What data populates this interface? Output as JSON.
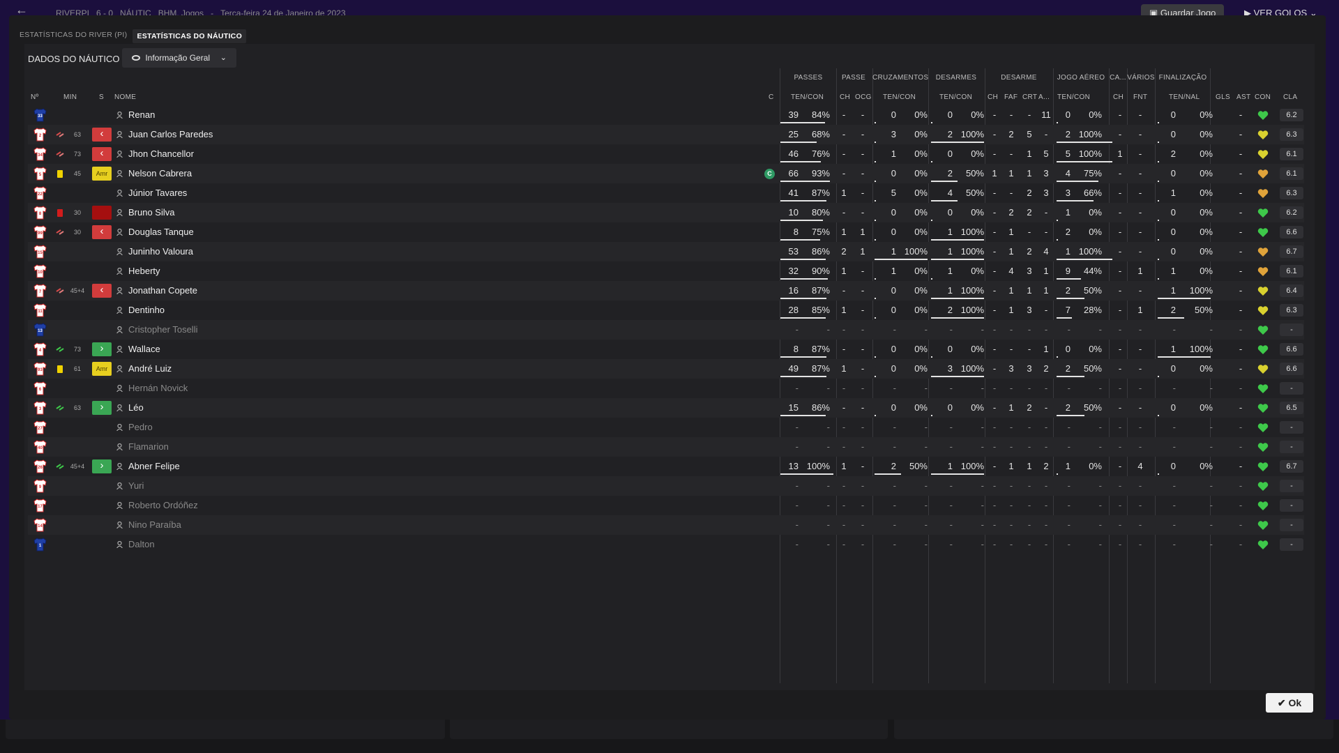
{
  "topbar": {
    "back_icon": "arrow-left-icon",
    "crumb": [
      "RIVERPI",
      "6 - 0",
      "NÁUTIC",
      "BHM. Jogos",
      "-",
      "Terça-feira 24 de Janeiro de 2023"
    ],
    "save_label": "Guardar Jogo",
    "goals_label": "VER GOLOS"
  },
  "tabs": [
    {
      "label": "ESTATÍSTICAS DO RIVER (PI)",
      "active": false
    },
    {
      "label": "ESTATÍSTICAS DO NÁUTICO",
      "active": true
    }
  ],
  "section_title": "DADOS DO NÁUTICO",
  "view_select": {
    "label": "Informação Geral",
    "icon": "eye-icon"
  },
  "groups": [
    "PASSES",
    "PASSE",
    "CRUZAMENTOS",
    "DESARMES",
    "DESARME",
    "JOGO AÉREO",
    "CA...",
    "VÁRIOS",
    "FINALIZAÇÃO"
  ],
  "headers": {
    "no": "Nº",
    "min": "MIN",
    "s": "S",
    "nome": "NOME",
    "c": "C",
    "passes": "TEN/CON",
    "passe_ch": "CH",
    "passe_ocg": "OCG",
    "cruz": "TEN/CON",
    "desarmes": "TEN/CON",
    "des_ch": "CH",
    "des_faf": "FAF",
    "des_crt": "CRT",
    "des_a": "A...",
    "aereo": "TEN/CON",
    "ca_ch": "CH",
    "varios_fnt": "FNT",
    "final": "TEN/NAL",
    "gls": "GLS",
    "ast": "AST",
    "con": "CON",
    "cla": "CLA"
  },
  "players": [
    {
      "no": "33",
      "gk": true,
      "min": "",
      "event": "",
      "badge": "",
      "name": "Renan",
      "dim": false,
      "c": false,
      "p": [
        "39",
        "84%"
      ],
      "pch": "-",
      "pocg": "-",
      "cr": [
        "0",
        "0%"
      ],
      "de": [
        "0",
        "0%"
      ],
      "dch": "-",
      "faf": "-",
      "crt": "-",
      "a": "11",
      "ae": [
        "0",
        "0%"
      ],
      "cach": "-",
      "fnt": "-",
      "fin": [
        "0",
        "0%"
      ],
      "gls": "",
      "ast": "-",
      "con": "green",
      "cla": "6.2"
    },
    {
      "no": "2",
      "gk": false,
      "min": "63",
      "event": "swap",
      "badge": "sub-off",
      "name": "Juan Carlos Paredes",
      "dim": false,
      "c": false,
      "p": [
        "25",
        "68%"
      ],
      "pch": "-",
      "pocg": "-",
      "cr": [
        "3",
        "0%"
      ],
      "de": [
        "2",
        "100%"
      ],
      "dch": "-",
      "faf": "2",
      "crt": "5",
      "a": "-",
      "ae": [
        "2",
        "100%"
      ],
      "cach": "-",
      "fnt": "-",
      "fin": [
        "0",
        "0%"
      ],
      "gls": "",
      "ast": "-",
      "con": "yellow",
      "cla": "6.3"
    },
    {
      "no": "34",
      "gk": false,
      "min": "73",
      "event": "swap",
      "badge": "sub-off",
      "name": "Jhon Chancellor",
      "dim": false,
      "c": false,
      "p": [
        "46",
        "76%"
      ],
      "pch": "-",
      "pocg": "-",
      "cr": [
        "1",
        "0%"
      ],
      "de": [
        "0",
        "0%"
      ],
      "dch": "-",
      "faf": "-",
      "crt": "1",
      "a": "5",
      "ae": [
        "5",
        "100%"
      ],
      "cach": "1",
      "fnt": "-",
      "fin": [
        "2",
        "0%"
      ],
      "gls": "",
      "ast": "-",
      "con": "yellow",
      "cla": "6.1"
    },
    {
      "no": "5",
      "gk": false,
      "min": "45",
      "event": "yellow",
      "badge": "amr",
      "name": "Nelson Cabrera",
      "dim": false,
      "c": true,
      "p": [
        "66",
        "93%"
      ],
      "pch": "-",
      "pocg": "-",
      "cr": [
        "0",
        "0%"
      ],
      "de": [
        "2",
        "50%"
      ],
      "dch": "1",
      "faf": "1",
      "crt": "1",
      "a": "3",
      "ae": [
        "4",
        "75%"
      ],
      "cach": "-",
      "fnt": "-",
      "fin": [
        "0",
        "0%"
      ],
      "gls": "",
      "ast": "-",
      "con": "orange",
      "cla": "6.1"
    },
    {
      "no": "22",
      "gk": false,
      "min": "",
      "event": "",
      "badge": "",
      "name": "Júnior Tavares",
      "dim": false,
      "c": false,
      "p": [
        "41",
        "87%"
      ],
      "pch": "1",
      "pocg": "-",
      "cr": [
        "5",
        "0%"
      ],
      "de": [
        "4",
        "50%"
      ],
      "dch": "-",
      "faf": "-",
      "crt": "2",
      "a": "3",
      "ae": [
        "3",
        "66%"
      ],
      "cach": "-",
      "fnt": "-",
      "fin": [
        "1",
        "0%"
      ],
      "gls": "",
      "ast": "-",
      "con": "orange",
      "cla": "6.3"
    },
    {
      "no": "8",
      "gk": false,
      "min": "30",
      "event": "red",
      "badge": "red",
      "name": "Bruno Silva",
      "dim": false,
      "c": false,
      "p": [
        "10",
        "80%"
      ],
      "pch": "-",
      "pocg": "-",
      "cr": [
        "0",
        "0%"
      ],
      "de": [
        "0",
        "0%"
      ],
      "dch": "-",
      "faf": "2",
      "crt": "2",
      "a": "-",
      "ae": [
        "1",
        "0%"
      ],
      "cach": "-",
      "fnt": "-",
      "fin": [
        "0",
        "0%"
      ],
      "gls": "",
      "ast": "-",
      "con": "green",
      "cla": "6.2"
    },
    {
      "no": "99",
      "gk": false,
      "min": "30",
      "event": "swap",
      "badge": "sub-off",
      "name": "Douglas Tanque",
      "dim": false,
      "c": false,
      "p": [
        "8",
        "75%"
      ],
      "pch": "1",
      "pocg": "1",
      "cr": [
        "0",
        "0%"
      ],
      "de": [
        "1",
        "100%"
      ],
      "dch": "-",
      "faf": "1",
      "crt": "-",
      "a": "-",
      "ae": [
        "2",
        "0%"
      ],
      "cach": "-",
      "fnt": "-",
      "fin": [
        "0",
        "0%"
      ],
      "gls": "",
      "ast": "-",
      "con": "green",
      "cla": "6.6"
    },
    {
      "no": "15",
      "gk": false,
      "min": "",
      "event": "",
      "badge": "",
      "name": "Juninho Valoura",
      "dim": false,
      "c": false,
      "p": [
        "53",
        "86%"
      ],
      "pch": "2",
      "pocg": "1",
      "cr": [
        "1",
        "100%"
      ],
      "de": [
        "1",
        "100%"
      ],
      "dch": "-",
      "faf": "1",
      "crt": "2",
      "a": "4",
      "ae": [
        "1",
        "100%"
      ],
      "cach": "-",
      "fnt": "-",
      "fin": [
        "0",
        "0%"
      ],
      "gls": "",
      "ast": "-",
      "con": "orange",
      "cla": "6.7"
    },
    {
      "no": "10",
      "gk": false,
      "min": "",
      "event": "",
      "badge": "",
      "name": "Heberty",
      "dim": false,
      "c": false,
      "p": [
        "32",
        "90%"
      ],
      "pch": "1",
      "pocg": "-",
      "cr": [
        "1",
        "0%"
      ],
      "de": [
        "1",
        "0%"
      ],
      "dch": "-",
      "faf": "4",
      "crt": "3",
      "a": "1",
      "ae": [
        "9",
        "44%"
      ],
      "cach": "-",
      "fnt": "1",
      "fin": [
        "1",
        "0%"
      ],
      "gls": "",
      "ast": "-",
      "con": "orange",
      "cla": "6.1"
    },
    {
      "no": "7",
      "gk": false,
      "min": "45+4",
      "event": "swap",
      "badge": "sub-off",
      "name": "Jonathan Copete",
      "dim": false,
      "c": false,
      "p": [
        "16",
        "87%"
      ],
      "pch": "-",
      "pocg": "-",
      "cr": [
        "0",
        "0%"
      ],
      "de": [
        "1",
        "100%"
      ],
      "dch": "-",
      "faf": "1",
      "crt": "1",
      "a": "1",
      "ae": [
        "2",
        "50%"
      ],
      "cach": "-",
      "fnt": "-",
      "fin": [
        "1",
        "100%"
      ],
      "gls": "",
      "ast": "-",
      "con": "yellow",
      "cla": "6.4"
    },
    {
      "no": "11",
      "gk": false,
      "min": "",
      "event": "",
      "badge": "",
      "name": "Dentinho",
      "dim": false,
      "c": false,
      "p": [
        "28",
        "85%"
      ],
      "pch": "1",
      "pocg": "-",
      "cr": [
        "0",
        "0%"
      ],
      "de": [
        "2",
        "100%"
      ],
      "dch": "-",
      "faf": "1",
      "crt": "3",
      "a": "-",
      "ae": [
        "7",
        "28%"
      ],
      "cach": "-",
      "fnt": "1",
      "fin": [
        "2",
        "50%"
      ],
      "gls": "",
      "ast": "-",
      "con": "yellow",
      "cla": "6.3"
    },
    {
      "no": "13",
      "gk": true,
      "min": "",
      "event": "",
      "badge": "",
      "name": "Cristopher Toselli",
      "dim": true,
      "c": false,
      "p": [
        "-",
        "-"
      ],
      "pch": "-",
      "pocg": "-",
      "cr": [
        "-",
        "-"
      ],
      "de": [
        "-",
        "-"
      ],
      "dch": "-",
      "faf": "-",
      "crt": "-",
      "a": "-",
      "ae": [
        "-",
        "-"
      ],
      "cach": "-",
      "fnt": "-",
      "fin": [
        "-",
        "-"
      ],
      "gls": "",
      "ast": "-",
      "con": "green",
      "cla": "-"
    },
    {
      "no": "4",
      "gk": false,
      "min": "73",
      "event": "swap-in",
      "badge": "sub-on",
      "name": "Wallace",
      "dim": false,
      "c": false,
      "p": [
        "8",
        "87%"
      ],
      "pch": "-",
      "pocg": "-",
      "cr": [
        "0",
        "0%"
      ],
      "de": [
        "0",
        "0%"
      ],
      "dch": "-",
      "faf": "-",
      "crt": "-",
      "a": "1",
      "ae": [
        "0",
        "0%"
      ],
      "cach": "-",
      "fnt": "-",
      "fin": [
        "1",
        "100%"
      ],
      "gls": "",
      "ast": "-",
      "con": "green",
      "cla": "6.6"
    },
    {
      "no": "93",
      "gk": false,
      "min": "61",
      "event": "yellow",
      "badge": "amr",
      "name": "André Luiz",
      "dim": false,
      "c": false,
      "p": [
        "49",
        "87%"
      ],
      "pch": "1",
      "pocg": "-",
      "cr": [
        "0",
        "0%"
      ],
      "de": [
        "3",
        "100%"
      ],
      "dch": "-",
      "faf": "3",
      "crt": "3",
      "a": "2",
      "ae": [
        "2",
        "50%"
      ],
      "cach": "-",
      "fnt": "-",
      "fin": [
        "0",
        "0%"
      ],
      "gls": "",
      "ast": "-",
      "con": "yellow",
      "cla": "6.6"
    },
    {
      "no": "6",
      "gk": false,
      "min": "",
      "event": "",
      "badge": "",
      "name": "Hernán Novick",
      "dim": true,
      "c": false,
      "p": [
        "-",
        "-"
      ],
      "pch": "-",
      "pocg": "-",
      "cr": [
        "-",
        "-"
      ],
      "de": [
        "-",
        "-"
      ],
      "dch": "-",
      "faf": "-",
      "crt": "-",
      "a": "-",
      "ae": [
        "-",
        "-"
      ],
      "cach": "-",
      "fnt": "-",
      "fin": [
        "-",
        "-"
      ],
      "gls": "",
      "ast": "-",
      "con": "green",
      "cla": "-"
    },
    {
      "no": "3",
      "gk": false,
      "min": "63",
      "event": "swap-in",
      "badge": "sub-on",
      "name": "Léo",
      "dim": false,
      "c": false,
      "p": [
        "15",
        "86%"
      ],
      "pch": "-",
      "pocg": "-",
      "cr": [
        "0",
        "0%"
      ],
      "de": [
        "0",
        "0%"
      ],
      "dch": "-",
      "faf": "1",
      "crt": "2",
      "a": "-",
      "ae": [
        "2",
        "50%"
      ],
      "cach": "-",
      "fnt": "-",
      "fin": [
        "0",
        "0%"
      ],
      "gls": "",
      "ast": "-",
      "con": "green",
      "cla": "6.5"
    },
    {
      "no": "27",
      "gk": false,
      "min": "",
      "event": "",
      "badge": "",
      "name": "Pedro",
      "dim": true,
      "c": false,
      "p": [
        "-",
        "-"
      ],
      "pch": "-",
      "pocg": "-",
      "cr": [
        "-",
        "-"
      ],
      "de": [
        "-",
        "-"
      ],
      "dch": "-",
      "faf": "-",
      "crt": "-",
      "a": "-",
      "ae": [
        "-",
        "-"
      ],
      "cach": "-",
      "fnt": "-",
      "fin": [
        "-",
        "-"
      ],
      "gls": "",
      "ast": "-",
      "con": "green",
      "cla": "-"
    },
    {
      "no": "40",
      "gk": false,
      "min": "",
      "event": "",
      "badge": "",
      "name": "Flamarion",
      "dim": true,
      "c": false,
      "p": [
        "-",
        "-"
      ],
      "pch": "-",
      "pocg": "-",
      "cr": [
        "-",
        "-"
      ],
      "de": [
        "-",
        "-"
      ],
      "dch": "-",
      "faf": "-",
      "crt": "-",
      "a": "-",
      "ae": [
        "-",
        "-"
      ],
      "cach": "-",
      "fnt": "-",
      "fin": [
        "-",
        "-"
      ],
      "gls": "",
      "ast": "-",
      "con": "green",
      "cla": "-"
    },
    {
      "no": "26",
      "gk": false,
      "min": "45+4",
      "event": "swap-in",
      "badge": "sub-on",
      "name": "Abner Felipe",
      "dim": false,
      "c": false,
      "p": [
        "13",
        "100%"
      ],
      "pch": "1",
      "pocg": "-",
      "cr": [
        "2",
        "50%"
      ],
      "de": [
        "1",
        "100%"
      ],
      "dch": "-",
      "faf": "1",
      "crt": "1",
      "a": "2",
      "ae": [
        "1",
        "0%"
      ],
      "cach": "-",
      "fnt": "4",
      "fin": [
        "0",
        "0%"
      ],
      "gls": "",
      "ast": "-",
      "con": "green",
      "cla": "6.7"
    },
    {
      "no": "9",
      "gk": false,
      "min": "",
      "event": "",
      "badge": "",
      "name": "Yuri",
      "dim": true,
      "c": false,
      "p": [
        "-",
        "-"
      ],
      "pch": "-",
      "pocg": "-",
      "cr": [
        "-",
        "-"
      ],
      "de": [
        "-",
        "-"
      ],
      "dch": "-",
      "faf": "-",
      "crt": "-",
      "a": "-",
      "ae": [
        "-",
        "-"
      ],
      "cach": "-",
      "fnt": "-",
      "fin": [
        "-",
        "-"
      ],
      "gls": "",
      "ast": "-",
      "con": "green",
      "cla": "-"
    },
    {
      "no": "17",
      "gk": false,
      "min": "",
      "event": "",
      "badge": "",
      "name": "Roberto Ordóñez",
      "dim": true,
      "c": false,
      "p": [
        "-",
        "-"
      ],
      "pch": "-",
      "pocg": "-",
      "cr": [
        "-",
        "-"
      ],
      "de": [
        "-",
        "-"
      ],
      "dch": "-",
      "faf": "-",
      "crt": "-",
      "a": "-",
      "ae": [
        "-",
        "-"
      ],
      "cach": "-",
      "fnt": "-",
      "fin": [
        "-",
        "-"
      ],
      "gls": "",
      "ast": "-",
      "con": "green",
      "cla": "-"
    },
    {
      "no": "14",
      "gk": false,
      "min": "",
      "event": "",
      "badge": "",
      "name": "Nino Paraíba",
      "dim": true,
      "c": false,
      "p": [
        "-",
        "-"
      ],
      "pch": "-",
      "pocg": "-",
      "cr": [
        "-",
        "-"
      ],
      "de": [
        "-",
        "-"
      ],
      "dch": "-",
      "faf": "-",
      "crt": "-",
      "a": "-",
      "ae": [
        "-",
        "-"
      ],
      "cach": "-",
      "fnt": "-",
      "fin": [
        "-",
        "-"
      ],
      "gls": "",
      "ast": "-",
      "con": "green",
      "cla": "-"
    },
    {
      "no": "1",
      "gk": true,
      "min": "",
      "event": "",
      "badge": "",
      "name": "Dalton",
      "dim": true,
      "c": false,
      "p": [
        "-",
        "-"
      ],
      "pch": "-",
      "pocg": "-",
      "cr": [
        "-",
        "-"
      ],
      "de": [
        "-",
        "-"
      ],
      "dch": "-",
      "faf": "-",
      "crt": "-",
      "a": "-",
      "ae": [
        "-",
        "-"
      ],
      "cach": "-",
      "fnt": "-",
      "fin": [
        "-",
        "-"
      ],
      "gls": "",
      "ast": "-",
      "con": "green",
      "cla": "-"
    }
  ],
  "badge_text": {
    "amr": "Amr",
    "sub-off": "‹",
    "sub-on": "›",
    "red": ""
  },
  "captain_mark": "C",
  "ok_label": "Ok",
  "colors": {
    "green": "#3ec94a",
    "yellow": "#d9d12f",
    "orange": "#e0a33a",
    "home_shirt": "#ffffff",
    "home_trim": "#d62828",
    "gk_shirt": "#1f3fa6"
  }
}
